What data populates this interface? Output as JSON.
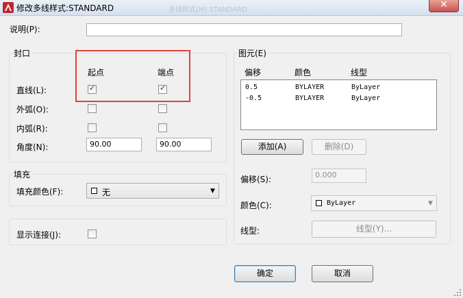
{
  "window": {
    "title": "修改多线样式:STANDARD",
    "background_ghost": "多线样式(M)  STANDARD",
    "close_glyph": "✕"
  },
  "description": {
    "label": "说明(P):",
    "value": ""
  },
  "caps": {
    "group_label": "封口",
    "col_start": "起点",
    "col_end": "端点",
    "rows": [
      {
        "label": "直线(L):",
        "start": true,
        "end": true
      },
      {
        "label": "外弧(O):",
        "start": false,
        "end": false
      },
      {
        "label": "内弧(R):",
        "start": false,
        "end": false
      }
    ],
    "angle": {
      "label": "角度(N):",
      "start": "90.00",
      "end": "90.00"
    }
  },
  "fill": {
    "group_label": "填充",
    "label": "填充颜色(F):",
    "value": "无"
  },
  "joints": {
    "label": "显示连接(J):",
    "checked": false
  },
  "elements": {
    "group_label": "图元(E)",
    "headers": {
      "offset": "偏移",
      "color": "颜色",
      "linetype": "线型"
    },
    "rows": [
      {
        "offset": "0.5",
        "color": "BYLAYER",
        "linetype": "ByLayer"
      },
      {
        "offset": "-0.5",
        "color": "BYLAYER",
        "linetype": "ByLayer"
      }
    ],
    "add_label": "添加(A)",
    "delete_label": "删除(D)",
    "offset_label": "偏移(S):",
    "offset_value": "0.000",
    "color_label": "颜色(C):",
    "color_value": "ByLayer",
    "linetype_label": "线型:",
    "linetype_button": "线型(Y)..."
  },
  "footer": {
    "ok": "确定",
    "cancel": "取消"
  },
  "colors": {
    "highlight_box": "#e0403a",
    "title_bar": "#d6e1ef",
    "dialog_bg": "#f0f0f0"
  }
}
